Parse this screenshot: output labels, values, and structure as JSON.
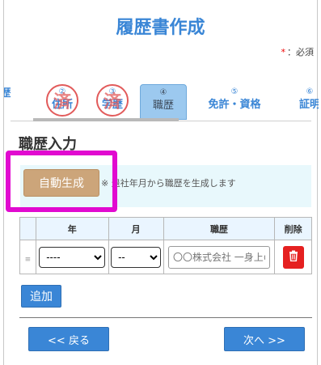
{
  "page": {
    "title": "履歴書作成"
  },
  "required_note": {
    "mark": "*",
    "text": "：必須"
  },
  "tabs": [
    {
      "num": "",
      "label": "歴",
      "state": "future"
    },
    {
      "num": "②",
      "label": "住所",
      "state": "done",
      "stamp": "済"
    },
    {
      "num": "③",
      "label": "学歴",
      "state": "done",
      "stamp": "済"
    },
    {
      "num": "④",
      "label": "職歴",
      "state": "current"
    },
    {
      "num": "⑤",
      "label": "免許・資格",
      "state": "future"
    },
    {
      "num": "⑥",
      "label": "証明",
      "state": "future"
    }
  ],
  "section": {
    "title": "職歴入力"
  },
  "auto_generate": {
    "button_label": "自動生成",
    "note": "※ 退社年月から職歴を生成します"
  },
  "table": {
    "headers": {
      "handle": "",
      "year": "年",
      "month": "月",
      "job": "職歴",
      "delete": "削除"
    },
    "rows": [
      {
        "handle": "≡",
        "year": "----",
        "month": "--",
        "job_placeholder": "〇〇株式会社 一身上の都合により退社",
        "job_value": ""
      }
    ]
  },
  "buttons": {
    "add": "追加",
    "back": "<< 戻る",
    "next": "次へ >>"
  },
  "icons": {
    "delete": "trash-icon"
  },
  "colors": {
    "accent": "#3a86d6",
    "stamp": "#e25b5b",
    "auto_button": "#cca57a",
    "highlight": "#e10ad0",
    "delete": "#e52020"
  }
}
